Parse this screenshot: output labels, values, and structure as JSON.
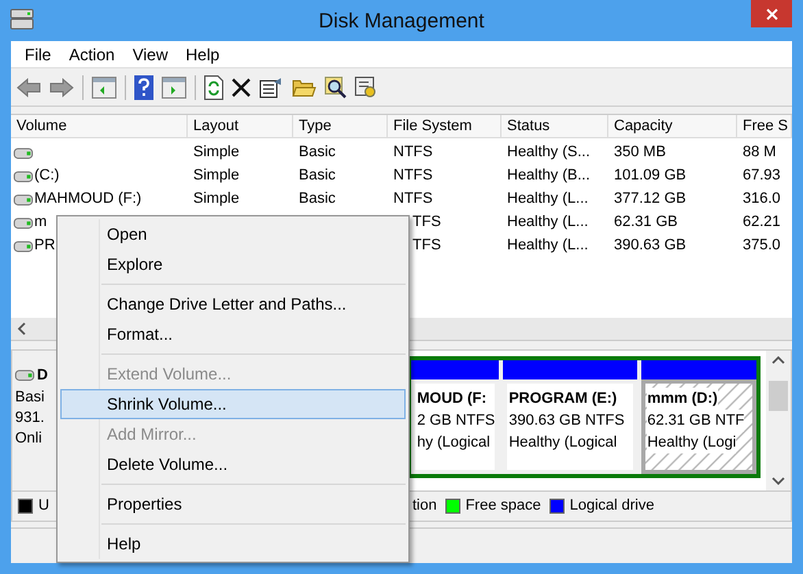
{
  "window": {
    "title": "Disk Management"
  },
  "menu_bar": [
    "File",
    "Action",
    "View",
    "Help"
  ],
  "volume_table": {
    "columns": [
      "Volume",
      "Layout",
      "Type",
      "File System",
      "Status",
      "Capacity",
      "Free S"
    ],
    "rows": [
      {
        "layout": "Simple",
        "type": "Basic",
        "file_system": "NTFS",
        "status": "Healthy (S...",
        "capacity": "350 MB",
        "free": "88 M"
      },
      {
        "volume": "(C:)",
        "layout": "Simple",
        "type": "Basic",
        "file_system": "NTFS",
        "status": "Healthy (B...",
        "capacity": "101.09 GB",
        "free": "67.93"
      },
      {
        "volume": "MAHMOUD (F:)",
        "layout": "Simple",
        "type": "Basic",
        "file_system": "NTFS",
        "status": "Healthy (L...",
        "capacity": "377.12 GB",
        "free": "316.0"
      },
      {
        "volume": "m",
        "file_system": "TFS",
        "status": "Healthy (L...",
        "capacity": "62.31 GB",
        "free": "62.21"
      },
      {
        "volume": "PR",
        "file_system": "TFS",
        "status": "Healthy (L...",
        "capacity": "390.63 GB",
        "free": "375.0"
      }
    ]
  },
  "disk": {
    "label": "D",
    "lines": [
      "Basi",
      "931.",
      "Onli"
    ]
  },
  "partitions": [
    {
      "name": "MOUD  (F:",
      "size": "2 GB NTFS",
      "status": "hy (Logical",
      "selected": false
    },
    {
      "name": "PROGRAM  (E:)",
      "size": "390.63 GB NTFS",
      "status": "Healthy (Logical",
      "selected": false
    },
    {
      "name": "mmm  (D:)",
      "size": "62.31 GB NTF",
      "status": "Healthy (Logi",
      "selected": true
    }
  ],
  "legend": [
    {
      "label": "U",
      "color": "#000000"
    },
    {
      "label": "tion"
    },
    {
      "label": "Free space",
      "color": "#00ff00"
    },
    {
      "label": "Logical drive",
      "color": "#0000ff"
    }
  ],
  "context_menu": [
    {
      "label": "Open",
      "disabled": false,
      "selected": false,
      "separator_after": false
    },
    {
      "label": "Explore",
      "disabled": false,
      "selected": false,
      "separator_after": true
    },
    {
      "label": "Change Drive Letter and Paths...",
      "disabled": false,
      "selected": false,
      "separator_after": false
    },
    {
      "label": "Format...",
      "disabled": false,
      "selected": false,
      "separator_after": true
    },
    {
      "label": "Extend Volume...",
      "disabled": true,
      "selected": false,
      "separator_after": false
    },
    {
      "label": "Shrink Volume...",
      "disabled": false,
      "selected": true,
      "separator_after": false
    },
    {
      "label": "Add Mirror...",
      "disabled": true,
      "selected": false,
      "separator_after": false
    },
    {
      "label": "Delete Volume...",
      "disabled": false,
      "selected": false,
      "separator_after": true
    },
    {
      "label": "Properties",
      "disabled": false,
      "selected": false,
      "separator_after": true
    },
    {
      "label": "Help",
      "disabled": false,
      "selected": false,
      "separator_after": false
    }
  ]
}
